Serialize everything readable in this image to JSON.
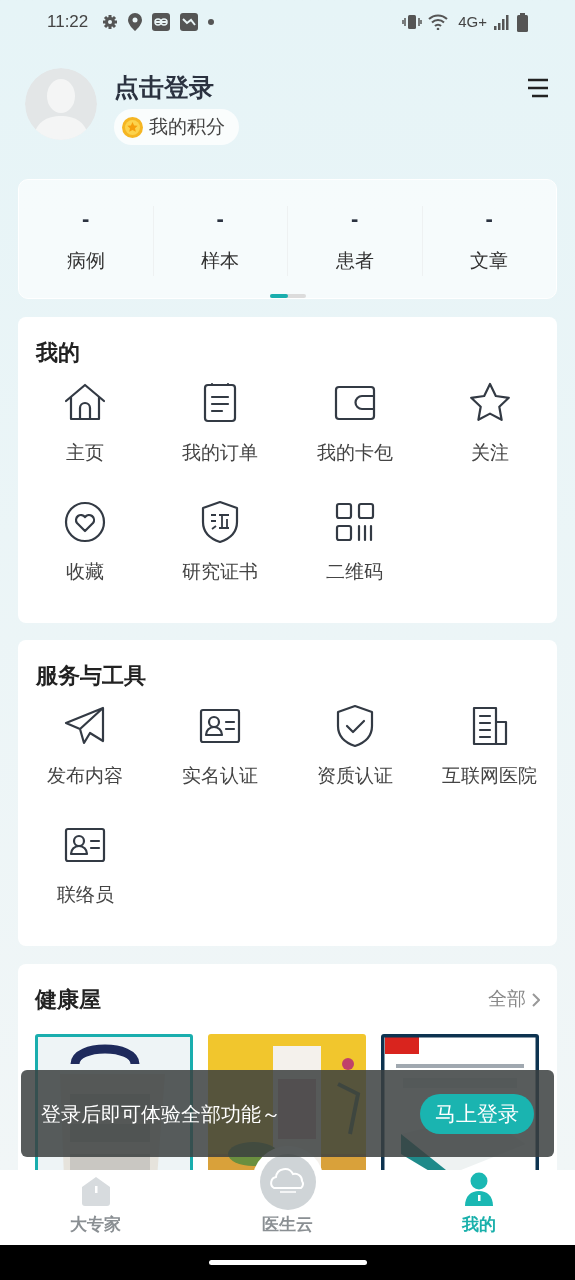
{
  "status_bar": {
    "time": "11:22",
    "network": "4G+"
  },
  "profile": {
    "login": "点击登录",
    "points": "我的积分"
  },
  "stats": [
    {
      "value": "-",
      "label": "病例"
    },
    {
      "value": "-",
      "label": "样本"
    },
    {
      "value": "-",
      "label": "患者"
    },
    {
      "value": "-",
      "label": "文章"
    }
  ],
  "my_section": {
    "title": "我的",
    "items": [
      {
        "label": "主页"
      },
      {
        "label": "我的订单"
      },
      {
        "label": "我的卡包"
      },
      {
        "label": "关注"
      },
      {
        "label": "收藏"
      },
      {
        "label": "研究证书"
      },
      {
        "label": "二维码"
      }
    ]
  },
  "services": {
    "title": "服务与工具",
    "items": [
      {
        "label": "发布内容"
      },
      {
        "label": "实名认证"
      },
      {
        "label": "资质认证"
      },
      {
        "label": "互联网医院"
      },
      {
        "label": "联络员"
      }
    ]
  },
  "health": {
    "title": "健康屋",
    "more": "全部"
  },
  "toast": {
    "message": "登录后即可体验全部功能～",
    "button": "马上登录"
  },
  "bottom_nav": [
    {
      "label": "大专家",
      "selected": false
    },
    {
      "label": "医生云",
      "selected": false
    },
    {
      "label": "我的",
      "selected": true
    }
  ]
}
